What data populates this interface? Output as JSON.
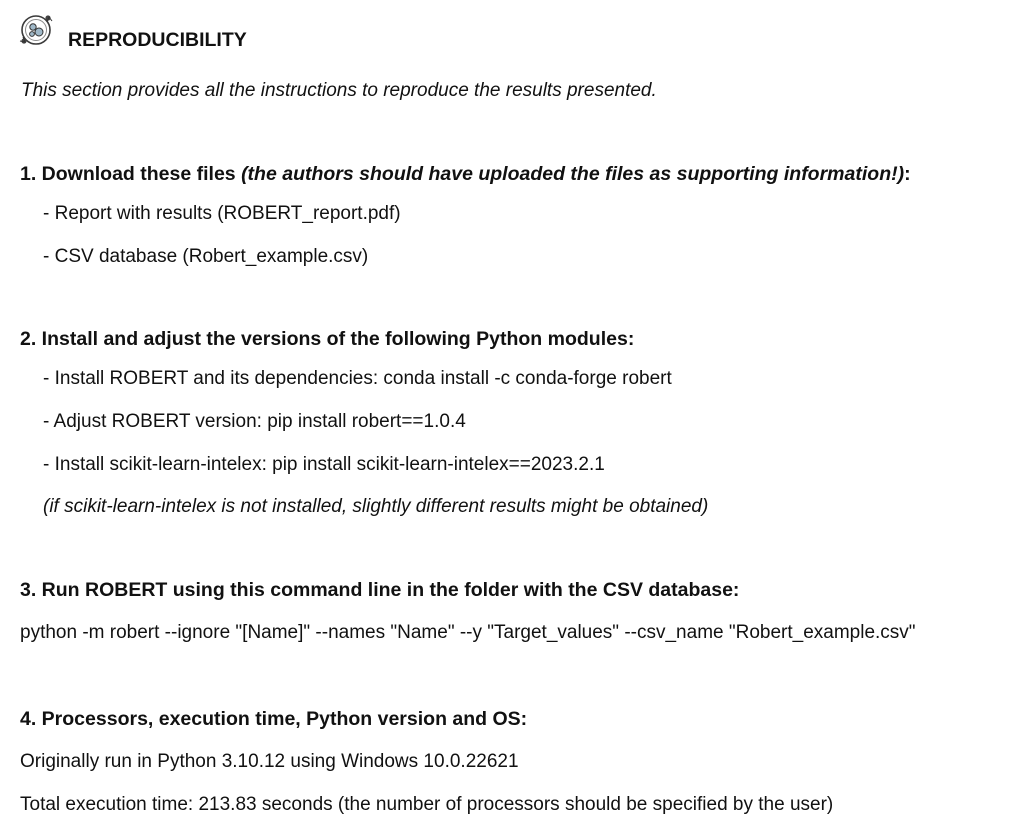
{
  "header": {
    "title": "REPRODUCIBILITY",
    "icon": "recycle-gears-icon"
  },
  "intro": "This section provides all the instructions to reproduce the results presented.",
  "step1": {
    "heading": "1. Download these files ",
    "heading_italic": "(the authors should have uploaded the files as supporting information!)",
    "heading_end": ":",
    "items": [
      "- Report with results (ROBERT_report.pdf)",
      "- CSV database (Robert_example.csv)"
    ]
  },
  "step2": {
    "heading": "2. Install and adjust the versions of the following Python modules:",
    "items": [
      "- Install ROBERT and its dependencies: conda install -c conda-forge robert",
      "- Adjust ROBERT version: pip install robert==1.0.4",
      "- Install scikit-learn-intelex: pip install scikit-learn-intelex==2023.2.1"
    ],
    "note": "(if scikit-learn-intelex is not installed, slightly different results might be obtained)"
  },
  "step3": {
    "heading": "3. Run ROBERT using this command line in the folder with the CSV database:",
    "command": "python -m robert --ignore \"[Name]\" --names \"Name\" --y \"Target_values\" --csv_name \"Robert_example.csv\""
  },
  "step4": {
    "heading": "4. Processors, execution time, Python version and OS:",
    "lines": [
      "Originally run in Python 3.10.12 using Windows 10.0.22621",
      "Total execution time: 213.83 seconds (the number of processors should be specified by the user)"
    ]
  }
}
